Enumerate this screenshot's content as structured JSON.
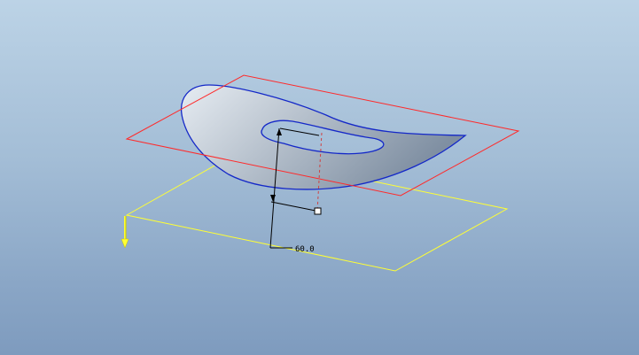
{
  "viewport": {
    "background_top": "#bcd3e6",
    "background_bottom": "#7e9bbe"
  },
  "colors": {
    "datum_plane_upper": "#ff2a2a",
    "datum_plane_lower": "#ffff33",
    "surface_edge": "#1428c8",
    "surface_fill_light": "#dfe6ee",
    "surface_fill_dark": "#8797aa",
    "dimension_line": "#000000",
    "reference_line": "#d04040",
    "csys_arrow": "#ffff33"
  },
  "dimension": {
    "value": "60.0"
  },
  "icons": {
    "drag_handle": "square-drag-handle-icon",
    "csys_axis": "axis-arrow-icon"
  }
}
